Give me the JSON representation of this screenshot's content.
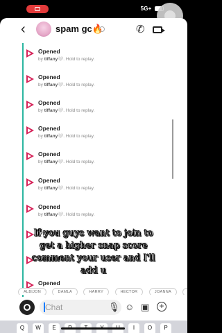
{
  "status_bar": {
    "signal": "5G+",
    "battery": ""
  },
  "header": {
    "back_icon": "chevron-left-icon",
    "title": "spam gc",
    "title_emoji": "🔥",
    "call_icon": "phone-icon",
    "video_icon": "video-camera-icon"
  },
  "messages": [
    {
      "status": "Opened",
      "by": "by",
      "user": "tiffany",
      "heart": "🤍",
      "hint": ". Hold to replay."
    },
    {
      "status": "Opened",
      "by": "by",
      "user": "tiffany",
      "heart": "🤍",
      "hint": ". Hold to replay."
    },
    {
      "status": "Opened",
      "by": "by",
      "user": "tiffany",
      "heart": "🤍",
      "hint": ". Hold to replay."
    },
    {
      "status": "Opened",
      "by": "by",
      "user": "tiffany",
      "heart": "🤍",
      "hint": ". Hold to replay."
    },
    {
      "status": "Opened",
      "by": "by",
      "user": "tiffany",
      "heart": "🤍",
      "hint": ". Hold to replay."
    },
    {
      "status": "Opened",
      "by": "by",
      "user": "tiffany",
      "heart": "🤍",
      "hint": ". Hold to replay."
    },
    {
      "status": "Opened",
      "by": "by",
      "user": "tiffany",
      "heart": "🤍",
      "hint": ". Hold to replay."
    },
    {
      "status": "Opened",
      "by": "",
      "user": "",
      "heart": "",
      "hint": ""
    },
    {
      "status": "Opened",
      "by": "",
      "user": "",
      "heart": "",
      "hint": ""
    },
    {
      "status": "Opened",
      "by": "",
      "user": "",
      "heart": "",
      "hint": ""
    }
  ],
  "caption": {
    "line1": "If you guys want to join to",
    "line2": "get a higher snap score",
    "line3": "comment your user and I'll",
    "line4": "add u"
  },
  "chips": [
    "ALBIJON",
    "DAMLA",
    "HARRY",
    "HECTOR",
    "JOANNA",
    "P"
  ],
  "input": {
    "placeholder": "Chat",
    "camera_icon": "camera-icon",
    "mic_icon": "microphone-icon",
    "emoji_icon": "smiley-icon",
    "sticker_icon": "sticker-icon",
    "plus_icon": "plus-icon"
  },
  "keyboard": {
    "keys": [
      "Q",
      "W",
      "E",
      "R",
      "T",
      "Y",
      "U",
      "I",
      "O",
      "P"
    ]
  },
  "colors": {
    "accent_rail": "#2bb6a0",
    "snap_red": "#d6245a",
    "status_pill": "#e23a3a"
  }
}
